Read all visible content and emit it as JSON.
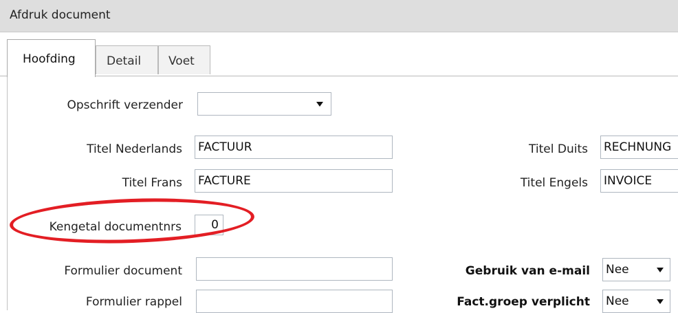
{
  "window": {
    "title": "Afdruk document"
  },
  "tabs": [
    {
      "label": "Hoofding",
      "active": true
    },
    {
      "label": "Detail",
      "active": false
    },
    {
      "label": "Voet",
      "active": false
    }
  ],
  "form": {
    "opschrift_verzender": {
      "label": "Opschrift verzender",
      "value": ""
    },
    "titel_nederlands": {
      "label": "Titel Nederlands",
      "value": "FACTUUR"
    },
    "titel_frans": {
      "label": "Titel Frans",
      "value": "FACTURE"
    },
    "titel_duits": {
      "label": "Titel Duits",
      "value": "RECHNUNG"
    },
    "titel_engels": {
      "label": "Titel Engels",
      "value": "INVOICE"
    },
    "kengetal_documentnrs": {
      "label": "Kengetal documentnrs",
      "value": "0"
    },
    "formulier_document": {
      "label": "Formulier document",
      "value": ""
    },
    "formulier_rappel": {
      "label": "Formulier rappel",
      "value": ""
    },
    "gebruik_van_email": {
      "label": "Gebruik van e-mail",
      "value": "Nee"
    },
    "fact_groep_verplicht": {
      "label": "Fact.groep verplicht",
      "value": "Nee"
    }
  },
  "annotation": {
    "color": "#e31e24",
    "shape": "ellipse"
  },
  "icons": {
    "dropdown": "chevron-down-icon"
  }
}
